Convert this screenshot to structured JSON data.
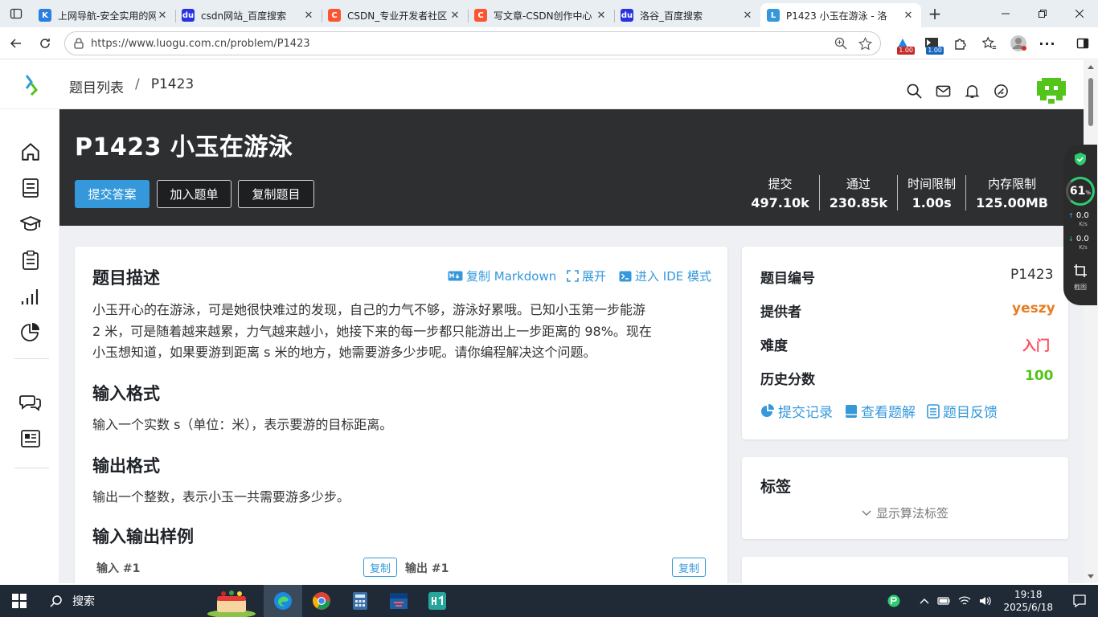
{
  "browser": {
    "tabs": [
      {
        "title": "上网导航-安全实用的网",
        "favicon_color": "#2a7de1",
        "favicon_glyph": "K"
      },
      {
        "title": "csdn网站_百度搜索",
        "favicon_color": "#2932e1",
        "favicon_glyph": "du"
      },
      {
        "title": "CSDN_专业开发者社区",
        "favicon_color": "#fc5531",
        "favicon_glyph": "C"
      },
      {
        "title": "写文章-CSDN创作中心",
        "favicon_color": "#fc5531",
        "favicon_glyph": "C"
      },
      {
        "title": "洛谷_百度搜索",
        "favicon_color": "#2932e1",
        "favicon_glyph": "du"
      },
      {
        "title": "P1423 小玉在游泳 - 洛",
        "favicon_color": "#3498db",
        "favicon_glyph": "L",
        "active": true
      }
    ],
    "url": "https://www.luogu.com.cn/problem/P1423",
    "ext_badges": [
      "1.00",
      "1.00"
    ]
  },
  "header": {
    "crumb_root": "题目列表",
    "crumb_sep": "/",
    "crumb_current": "P1423"
  },
  "banner": {
    "title": "P1423 小玉在游泳",
    "btn_submit": "提交答案",
    "btn_add": "加入题单",
    "btn_copy": "复制题目",
    "stats": [
      {
        "label": "提交",
        "value": "497.10k"
      },
      {
        "label": "通过",
        "value": "230.85k"
      },
      {
        "label": "时间限制",
        "value": "1.00s"
      },
      {
        "label": "内存限制",
        "value": "125.00MB"
      }
    ]
  },
  "problem": {
    "desc_title": "题目描述",
    "act_markdown": "复制 Markdown",
    "act_expand": "展开",
    "act_ide": "进入 IDE 模式",
    "desc_lines": [
      "小玉开心的在游泳，可是她很快难过的发现，自己的力气不够，游泳好累哦。已知小玉第一步能游",
      "2 米，可是随着越来越累，力气越来越小，她接下来的每一步都只能游出上一步距离的 98%。现在",
      "小玉想知道，如果要游到距离 s 米的地方，她需要游多少步呢。请你编程解决这个问题。"
    ],
    "input_title": "输入格式",
    "input_text": "输入一个实数 s（单位：米），表示要游的目标距离。",
    "output_title": "输出格式",
    "output_text": "输出一个整数，表示小玉一共需要游多少步。",
    "samples_title": "输入输出样例",
    "sample_in": "输入 #1",
    "sample_out": "输出 #1",
    "copy_label": "复制"
  },
  "info": {
    "rows": [
      {
        "label": "题目编号",
        "value": "P1423",
        "color": "#333333"
      },
      {
        "label": "提供者",
        "value": "yeszy",
        "color": "#e67e22"
      },
      {
        "label": "难度",
        "value": "入门",
        "color": "#fe4c61"
      },
      {
        "label": "历史分数",
        "value": "100",
        "color": "#52c41a"
      }
    ],
    "link_records": "提交记录",
    "link_solutions": "查看题解",
    "link_feedback": "题目反馈"
  },
  "tags": {
    "title": "标签",
    "toggle": "显示算法标签"
  },
  "float_widget": {
    "percent": "61",
    "percent_unit": "%",
    "up_value": "0.0",
    "up_unit": "K/s",
    "down_value": "0.0",
    "down_unit": "K/s",
    "screenshot_label": "截图"
  },
  "taskbar": {
    "search_label": "搜索",
    "time": "19:18",
    "date": "2025/6/18"
  }
}
